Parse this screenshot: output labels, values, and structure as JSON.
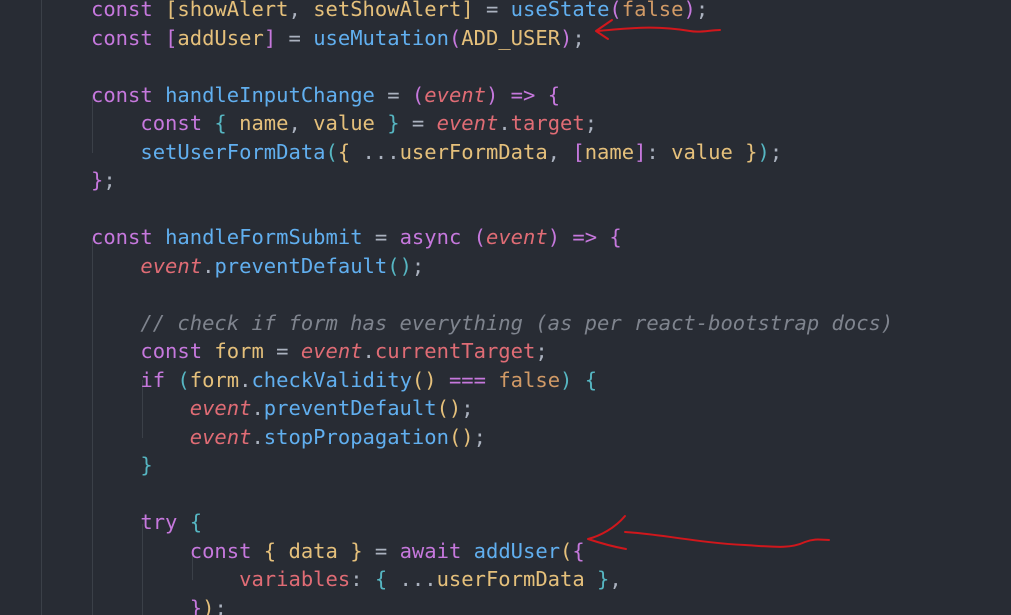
{
  "lines": [
    {
      "tokens": [
        {
          "t": "const ",
          "c": "kw"
        },
        {
          "t": "[",
          "c": "b1"
        },
        {
          "t": "showAlert",
          "c": "var"
        },
        {
          "t": ", ",
          "c": "pun"
        },
        {
          "t": "setShowAlert",
          "c": "var"
        },
        {
          "t": "]",
          "c": "b1"
        },
        {
          "t": " = ",
          "c": "pun"
        },
        {
          "t": "useState",
          "c": "fn"
        },
        {
          "t": "(",
          "c": "b2"
        },
        {
          "t": "false",
          "c": "bool"
        },
        {
          "t": ")",
          "c": "b2"
        },
        {
          "t": ";",
          "c": "pun"
        }
      ]
    },
    {
      "tokens": [
        {
          "t": "const ",
          "c": "kw"
        },
        {
          "t": "[",
          "c": "b2"
        },
        {
          "t": "addUser",
          "c": "var"
        },
        {
          "t": "]",
          "c": "b2"
        },
        {
          "t": " = ",
          "c": "pun"
        },
        {
          "t": "useMutation",
          "c": "fn"
        },
        {
          "t": "(",
          "c": "b2"
        },
        {
          "t": "ADD_USER",
          "c": "var"
        },
        {
          "t": ")",
          "c": "b2"
        },
        {
          "t": ";",
          "c": "pun"
        }
      ]
    },
    {
      "tokens": []
    },
    {
      "tokens": [
        {
          "t": "const ",
          "c": "kw"
        },
        {
          "t": "handleInputChange",
          "c": "fn"
        },
        {
          "t": " = ",
          "c": "pun"
        },
        {
          "t": "(",
          "c": "b2"
        },
        {
          "t": "event",
          "c": "param"
        },
        {
          "t": ")",
          "c": "b2"
        },
        {
          "t": " => ",
          "c": "kw"
        },
        {
          "t": "{",
          "c": "b2"
        }
      ]
    },
    {
      "tokens": [
        {
          "t": "    const ",
          "c": "kw"
        },
        {
          "t": "{",
          "c": "b3"
        },
        {
          "t": " name",
          "c": "var"
        },
        {
          "t": ", ",
          "c": "pun"
        },
        {
          "t": "value",
          "c": "var"
        },
        {
          "t": " }",
          "c": "b3"
        },
        {
          "t": " = ",
          "c": "pun"
        },
        {
          "t": "event",
          "c": "param"
        },
        {
          "t": ".",
          "c": "pun"
        },
        {
          "t": "target",
          "c": "prop"
        },
        {
          "t": ";",
          "c": "pun"
        }
      ]
    },
    {
      "tokens": [
        {
          "t": "    setUserFormData",
          "c": "fn"
        },
        {
          "t": "(",
          "c": "b3"
        },
        {
          "t": "{",
          "c": "b1"
        },
        {
          "t": " ...",
          "c": "pun"
        },
        {
          "t": "userFormData",
          "c": "var"
        },
        {
          "t": ", ",
          "c": "pun"
        },
        {
          "t": "[",
          "c": "b2"
        },
        {
          "t": "name",
          "c": "var"
        },
        {
          "t": "]",
          "c": "b2"
        },
        {
          "t": ": ",
          "c": "pun"
        },
        {
          "t": "value",
          "c": "var"
        },
        {
          "t": " }",
          "c": "b1"
        },
        {
          "t": ")",
          "c": "b3"
        },
        {
          "t": ";",
          "c": "pun"
        }
      ]
    },
    {
      "tokens": [
        {
          "t": "}",
          "c": "b2"
        },
        {
          "t": ";",
          "c": "pun"
        }
      ]
    },
    {
      "tokens": []
    },
    {
      "tokens": [
        {
          "t": "const ",
          "c": "kw"
        },
        {
          "t": "handleFormSubmit",
          "c": "fn"
        },
        {
          "t": " = ",
          "c": "pun"
        },
        {
          "t": "async ",
          "c": "kw"
        },
        {
          "t": "(",
          "c": "b2"
        },
        {
          "t": "event",
          "c": "param"
        },
        {
          "t": ")",
          "c": "b2"
        },
        {
          "t": " => ",
          "c": "kw"
        },
        {
          "t": "{",
          "c": "b2"
        }
      ]
    },
    {
      "tokens": [
        {
          "t": "    event",
          "c": "param"
        },
        {
          "t": ".",
          "c": "pun"
        },
        {
          "t": "preventDefault",
          "c": "fn"
        },
        {
          "t": "()",
          "c": "b3"
        },
        {
          "t": ";",
          "c": "pun"
        }
      ]
    },
    {
      "tokens": []
    },
    {
      "tokens": [
        {
          "t": "    // check if form has everything (as per react-bootstrap docs)",
          "c": "cmt"
        }
      ]
    },
    {
      "tokens": [
        {
          "t": "    const ",
          "c": "kw"
        },
        {
          "t": "form",
          "c": "var"
        },
        {
          "t": " = ",
          "c": "pun"
        },
        {
          "t": "event",
          "c": "param"
        },
        {
          "t": ".",
          "c": "pun"
        },
        {
          "t": "currentTarget",
          "c": "prop"
        },
        {
          "t": ";",
          "c": "pun"
        }
      ]
    },
    {
      "tokens": [
        {
          "t": "    if ",
          "c": "kw"
        },
        {
          "t": "(",
          "c": "b3"
        },
        {
          "t": "form",
          "c": "var"
        },
        {
          "t": ".",
          "c": "pun"
        },
        {
          "t": "checkValidity",
          "c": "fn"
        },
        {
          "t": "()",
          "c": "b1"
        },
        {
          "t": " === ",
          "c": "kw"
        },
        {
          "t": "false",
          "c": "bool"
        },
        {
          "t": ")",
          "c": "b3"
        },
        {
          "t": " {",
          "c": "b3"
        }
      ]
    },
    {
      "tokens": [
        {
          "t": "        event",
          "c": "param"
        },
        {
          "t": ".",
          "c": "pun"
        },
        {
          "t": "preventDefault",
          "c": "fn"
        },
        {
          "t": "()",
          "c": "b1"
        },
        {
          "t": ";",
          "c": "pun"
        }
      ]
    },
    {
      "tokens": [
        {
          "t": "        event",
          "c": "param"
        },
        {
          "t": ".",
          "c": "pun"
        },
        {
          "t": "stopPropagation",
          "c": "fn"
        },
        {
          "t": "()",
          "c": "b1"
        },
        {
          "t": ";",
          "c": "pun"
        }
      ]
    },
    {
      "tokens": [
        {
          "t": "    }",
          "c": "b3"
        }
      ]
    },
    {
      "tokens": []
    },
    {
      "tokens": [
        {
          "t": "    try ",
          "c": "kw"
        },
        {
          "t": "{",
          "c": "b3"
        }
      ]
    },
    {
      "tokens": [
        {
          "t": "        const ",
          "c": "kw"
        },
        {
          "t": "{",
          "c": "b1"
        },
        {
          "t": " data",
          "c": "var"
        },
        {
          "t": " }",
          "c": "b1"
        },
        {
          "t": " = ",
          "c": "pun"
        },
        {
          "t": "await ",
          "c": "kw"
        },
        {
          "t": "addUser",
          "c": "fn"
        },
        {
          "t": "(",
          "c": "b1"
        },
        {
          "t": "{",
          "c": "b2"
        }
      ]
    },
    {
      "tokens": [
        {
          "t": "            variables",
          "c": "prop"
        },
        {
          "t": ": ",
          "c": "pun"
        },
        {
          "t": "{",
          "c": "b3"
        },
        {
          "t": " ...",
          "c": "pun"
        },
        {
          "t": "userFormData",
          "c": "var"
        },
        {
          "t": " }",
          "c": "b3"
        },
        {
          "t": ",",
          "c": "pun"
        }
      ]
    },
    {
      "tokens": [
        {
          "t": "        }",
          "c": "b2"
        },
        {
          "t": ")",
          "c": "b1"
        },
        {
          "t": ";",
          "c": "pun"
        }
      ]
    }
  ],
  "annotations": {
    "color": "#d0171c",
    "arrows": [
      "arrow-to-useMutation-line",
      "arrow-to-addUser-call"
    ]
  }
}
